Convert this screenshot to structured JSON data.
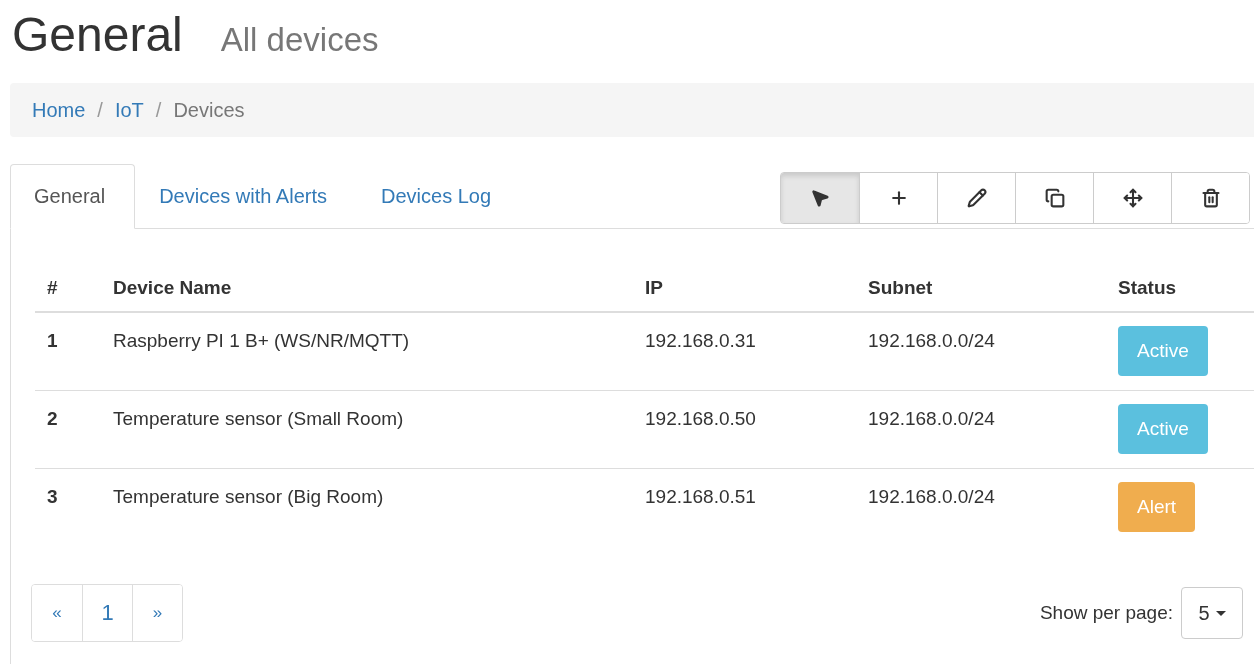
{
  "header": {
    "title": "General",
    "subtitle": "All devices"
  },
  "breadcrumb_separator": "/",
  "breadcrumb": [
    {
      "label": "Home",
      "link": true
    },
    {
      "label": "IoT",
      "link": true
    },
    {
      "label": "Devices",
      "link": false
    }
  ],
  "tabs": [
    {
      "label": "General",
      "selected": true
    },
    {
      "label": "Devices with Alerts",
      "selected": false
    },
    {
      "label": "Devices Log",
      "selected": false
    }
  ],
  "toolbar": [
    {
      "kind": "select",
      "selected": true
    },
    {
      "kind": "add",
      "selected": false
    },
    {
      "kind": "edit",
      "selected": false
    },
    {
      "kind": "copy",
      "selected": false
    },
    {
      "kind": "move",
      "selected": false
    },
    {
      "kind": "delete",
      "selected": false
    }
  ],
  "table": {
    "columns": [
      "#",
      "Device Name",
      "IP",
      "Subnet",
      "Status"
    ],
    "rows": [
      {
        "num": "1",
        "name": "Raspberry PI 1 B+ (WS/NR/MQTT)",
        "ip": "192.168.0.31",
        "subnet": "192.168.0.0/24",
        "status": {
          "label": "Active",
          "kind": "active"
        }
      },
      {
        "num": "2",
        "name": "Temperature sensor (Small Room)",
        "ip": "192.168.0.50",
        "subnet": "192.168.0.0/24",
        "status": {
          "label": "Active",
          "kind": "active"
        }
      },
      {
        "num": "3",
        "name": "Temperature sensor (Big Room)",
        "ip": "192.168.0.51",
        "subnet": "192.168.0.0/24",
        "status": {
          "label": "Alert",
          "kind": "alert"
        }
      }
    ]
  },
  "pagination": {
    "prev": "«",
    "pages": [
      "1"
    ],
    "next": "»"
  },
  "per_page": {
    "label": "Show per page:",
    "value": "5"
  }
}
